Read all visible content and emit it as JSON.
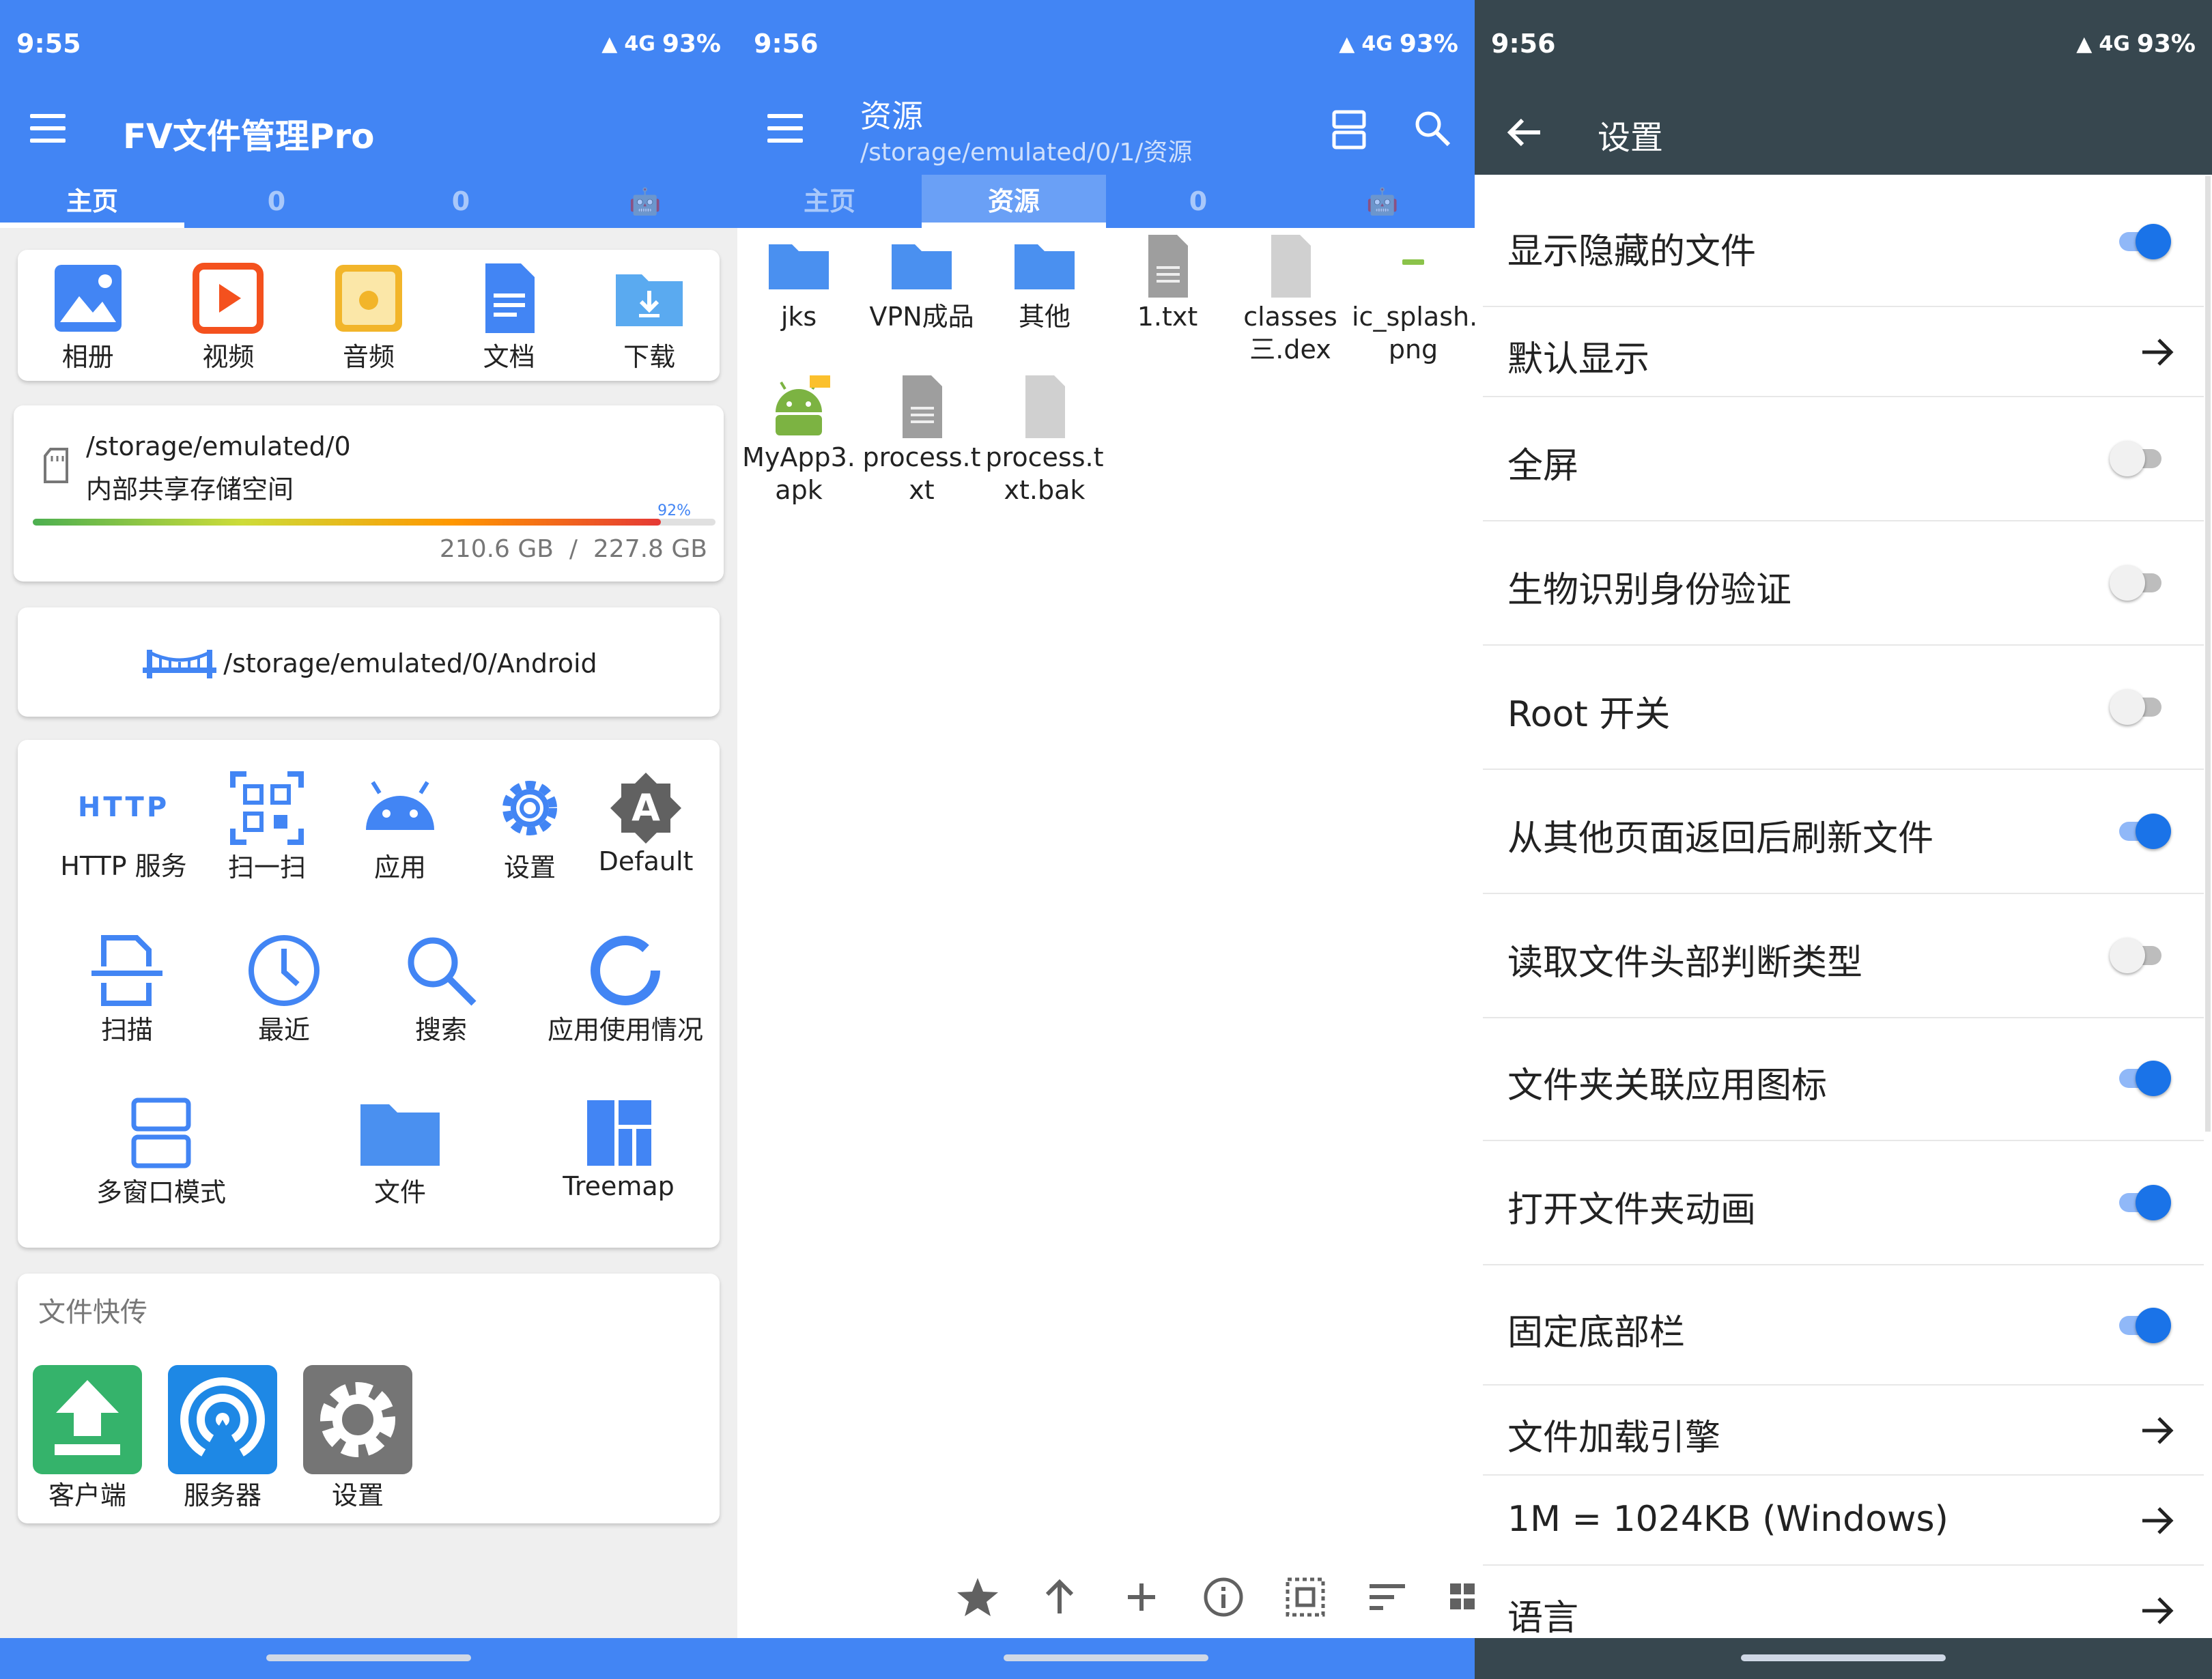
{
  "status": [
    {
      "time": "9:55",
      "battery": "93%",
      "net": "4G"
    },
    {
      "time": "9:56",
      "battery": "93%",
      "net": "4G"
    },
    {
      "time": "9:56",
      "battery": "93%",
      "net": "4G"
    }
  ],
  "home": {
    "title": "FV文件管理Pro",
    "tabs": [
      "主页",
      "0",
      "0"
    ],
    "categories": [
      "相册",
      "视频",
      "音频",
      "文档",
      "下载"
    ],
    "storage": {
      "path": "/storage/emulated/0",
      "name": "内部共享存储空间",
      "percent": "92%",
      "usage": "210.6 GB  /  227.8 GB",
      "used_fraction": 0.92
    },
    "android_path": "/storage/emulated/0/Android",
    "tools": [
      "HTTP 服务",
      "扫一扫",
      "应用",
      "设置",
      "Default",
      "扫描",
      "最近",
      "搜索",
      "应用使用情况",
      "多窗口模式",
      "文件",
      "Treemap"
    ],
    "http_icon_text": "HTTP",
    "default_icon_text": "A",
    "transfer": {
      "title": "文件快传",
      "items": [
        "客户端",
        "服务器",
        "设置"
      ]
    }
  },
  "browser": {
    "title": "资源",
    "subtitle": "/storage/emulated/0/1/资源",
    "tabs": [
      "主页",
      "资源",
      "0"
    ],
    "files": [
      {
        "name": "jks",
        "type": "folder"
      },
      {
        "name": "VPN成品",
        "type": "folder"
      },
      {
        "name": "其他",
        "type": "folder"
      },
      {
        "name": "1.txt",
        "type": "text"
      },
      {
        "name": "classes\n三.dex",
        "type": "file"
      },
      {
        "name": "ic_splash.\npng",
        "type": "image"
      },
      {
        "name": "MyApp3.\napk",
        "type": "apk"
      },
      {
        "name": "process.t\nxt",
        "type": "text"
      },
      {
        "name": "process.t\nxt.bak",
        "type": "file"
      }
    ]
  },
  "settings": {
    "title": "设置",
    "items": [
      {
        "label": "显示隐藏的文件",
        "kind": "toggle",
        "on": true
      },
      {
        "label": "默认显示",
        "kind": "arrow"
      },
      {
        "label": "全屏",
        "kind": "toggle",
        "on": false
      },
      {
        "label": "生物识别身份验证",
        "kind": "toggle",
        "on": false
      },
      {
        "label": "Root 开关",
        "kind": "toggle",
        "on": false
      },
      {
        "label": "从其他页面返回后刷新文件",
        "kind": "toggle",
        "on": true
      },
      {
        "label": "读取文件头部判断类型",
        "kind": "toggle",
        "on": false
      },
      {
        "label": "文件夹关联应用图标",
        "kind": "toggle",
        "on": true
      },
      {
        "label": "打开文件夹动画",
        "kind": "toggle",
        "on": true
      },
      {
        "label": "固定底部栏",
        "kind": "toggle",
        "on": true
      },
      {
        "label": "文件加载引擎",
        "kind": "arrow"
      },
      {
        "label": "1M = 1024KB (Windows)",
        "kind": "arrow"
      },
      {
        "label": "语言",
        "kind": "arrow"
      }
    ]
  },
  "colors": {
    "primary": "#4285f4",
    "settings_bar": "#37474f",
    "toggle_on": "#1a73e8",
    "folder": "#4a90f0",
    "transfer_green": "#35b36b",
    "transfer_blue": "#1e88e5",
    "transfer_gray": "#757575"
  }
}
